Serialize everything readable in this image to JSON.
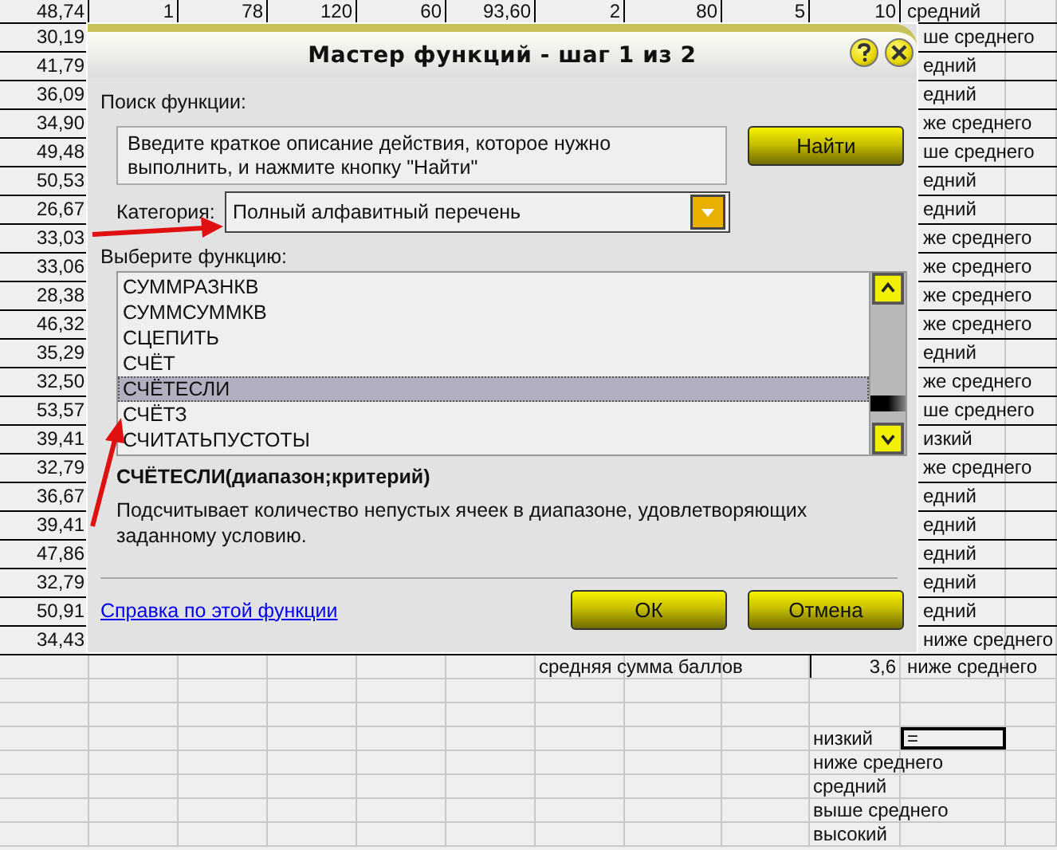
{
  "sheet": {
    "rows": [
      {
        "kind": "data",
        "cells": [
          "48,74",
          "1",
          "78",
          "120",
          "60",
          "93,60",
          "2",
          "80",
          "5",
          "10",
          "средний"
        ]
      },
      {
        "kind": "data",
        "cells": [
          "30,19",
          "",
          "",
          "",
          "",
          "",
          "",
          "",
          "",
          "",
          "ше среднего"
        ]
      },
      {
        "kind": "data",
        "cells": [
          "41,79",
          "",
          "",
          "",
          "",
          "",
          "",
          "",
          "",
          "",
          "едний"
        ]
      },
      {
        "kind": "data",
        "cells": [
          "36,09",
          "",
          "",
          "",
          "",
          "",
          "",
          "",
          "",
          "",
          "едний"
        ]
      },
      {
        "kind": "data",
        "cells": [
          "34,90",
          "",
          "",
          "",
          "",
          "",
          "",
          "",
          "",
          "",
          "же среднего"
        ]
      },
      {
        "kind": "data",
        "cells": [
          "49,48",
          "",
          "",
          "",
          "",
          "",
          "",
          "",
          "",
          "",
          "ше среднего"
        ]
      },
      {
        "kind": "data",
        "cells": [
          "50,53",
          "",
          "",
          "",
          "",
          "",
          "",
          "",
          "",
          "",
          "едний"
        ]
      },
      {
        "kind": "data",
        "cells": [
          "26,67",
          "",
          "",
          "",
          "",
          "",
          "",
          "",
          "",
          "",
          "едний"
        ]
      },
      {
        "kind": "data",
        "cells": [
          "33,03",
          "",
          "",
          "",
          "",
          "",
          "",
          "",
          "",
          "",
          "же среднего"
        ]
      },
      {
        "kind": "data",
        "cells": [
          "33,06",
          "",
          "",
          "",
          "",
          "",
          "",
          "",
          "",
          "",
          "же среднего"
        ]
      },
      {
        "kind": "data",
        "cells": [
          "28,38",
          "",
          "",
          "",
          "",
          "",
          "",
          "",
          "",
          "",
          "же среднего"
        ]
      },
      {
        "kind": "data",
        "cells": [
          "46,32",
          "",
          "",
          "",
          "",
          "",
          "",
          "",
          "",
          "",
          "же среднего"
        ]
      },
      {
        "kind": "data",
        "cells": [
          "35,29",
          "",
          "",
          "",
          "",
          "",
          "",
          "",
          "",
          "",
          "едний"
        ]
      },
      {
        "kind": "data",
        "cells": [
          "32,50",
          "",
          "",
          "",
          "",
          "",
          "",
          "",
          "",
          "",
          "же среднего"
        ]
      },
      {
        "kind": "data",
        "cells": [
          "53,57",
          "",
          "",
          "",
          "",
          "",
          "",
          "",
          "",
          "",
          "ше среднего"
        ]
      },
      {
        "kind": "data",
        "cells": [
          "39,41",
          "",
          "",
          "",
          "",
          "",
          "",
          "",
          "",
          "",
          "изкий"
        ]
      },
      {
        "kind": "data",
        "cells": [
          "32,79",
          "",
          "",
          "",
          "",
          "",
          "",
          "",
          "",
          "",
          "же среднего"
        ]
      },
      {
        "kind": "data",
        "cells": [
          "36,67",
          "",
          "",
          "",
          "",
          "",
          "",
          "",
          "",
          "",
          "едний"
        ]
      },
      {
        "kind": "data",
        "cells": [
          "39,41",
          "",
          "",
          "",
          "",
          "",
          "",
          "",
          "",
          "",
          "едний"
        ]
      },
      {
        "kind": "data",
        "cells": [
          "47,86",
          "",
          "",
          "",
          "",
          "",
          "",
          "",
          "",
          "",
          "едний"
        ]
      },
      {
        "kind": "data",
        "cells": [
          "32,79",
          "",
          "",
          "",
          "",
          "",
          "",
          "",
          "",
          "",
          "едний"
        ]
      },
      {
        "kind": "data",
        "cells": [
          "50,91",
          "",
          "",
          "",
          "",
          "",
          "",
          "",
          "",
          "",
          "едний"
        ]
      },
      {
        "kind": "data",
        "cells": [
          "34,43",
          "",
          "",
          "",
          "",
          "",
          "",
          "",
          "",
          "",
          "ниже среднего"
        ]
      },
      {
        "kind": "summary",
        "cells": [
          "",
          "",
          "",
          "",
          "",
          "",
          "средняя сумма баллов",
          "",
          "",
          "3,6",
          "ниже среднего"
        ]
      },
      {
        "kind": "legend"
      },
      {
        "kind": "legend"
      },
      {
        "kind": "legend",
        "active": true,
        "cells": [
          "",
          "",
          "",
          "",
          "",
          "",
          "",
          "",
          "",
          "низкий",
          "="
        ]
      },
      {
        "kind": "legend",
        "cells": [
          "",
          "",
          "",
          "",
          "",
          "",
          "",
          "",
          "",
          "ниже среднего"
        ]
      },
      {
        "kind": "legend",
        "cells": [
          "",
          "",
          "",
          "",
          "",
          "",
          "",
          "",
          "",
          "средний"
        ]
      },
      {
        "kind": "legend",
        "cells": [
          "",
          "",
          "",
          "",
          "",
          "",
          "",
          "",
          "",
          "выше среднего"
        ]
      },
      {
        "kind": "legend",
        "cells": [
          "",
          "",
          "",
          "",
          "",
          "",
          "",
          "",
          "",
          "высокий"
        ]
      }
    ]
  },
  "dialog": {
    "title": "Мастер функций - шаг 1 из 2",
    "search_label": "Поиск функции:",
    "search_field": {
      "placeholder": "Введите краткое описание действия, которое нужно выполнить, и нажмите кнопку \"Найти\""
    },
    "find_button": "Найти",
    "category_label": "Категория:",
    "category_value": "Полный алфавитный перечень",
    "function_label": "Выберите функцию:",
    "functions": [
      {
        "name": "СУММРАЗНКВ",
        "selected": false
      },
      {
        "name": "СУММСУММКВ",
        "selected": false
      },
      {
        "name": "СЦЕПИТЬ",
        "selected": false
      },
      {
        "name": "СЧЁТ",
        "selected": false
      },
      {
        "name": "СЧЁТЕСЛИ",
        "selected": true
      },
      {
        "name": "СЧЁТЗ",
        "selected": false
      },
      {
        "name": "СЧИТАТЬПУСТОТЫ",
        "selected": false
      }
    ],
    "signature": "СЧЁТЕСЛИ(диапазон;критерий)",
    "description": "Подсчитывает количество непустых ячеек в диапазоне, удовлетворяющих заданному условию.",
    "help_link": "Справка по этой функции",
    "buttons": [
      "ОК",
      "Отмена"
    ]
  }
}
